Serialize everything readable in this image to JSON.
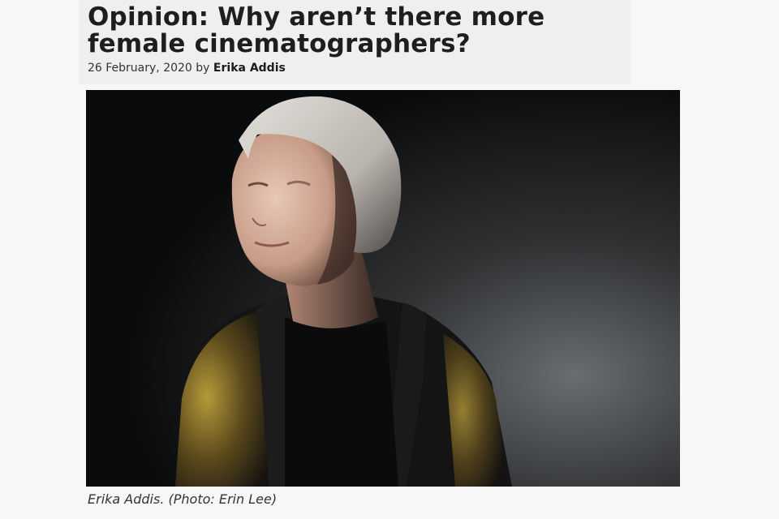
{
  "article": {
    "title": "Opinion: Why aren’t there more female cinematographers?",
    "date": "26 February, 2020",
    "by_label": "by",
    "author": "Erika Addis"
  },
  "photo": {
    "caption": "Erika Addis. (Photo: Erin Lee)"
  }
}
